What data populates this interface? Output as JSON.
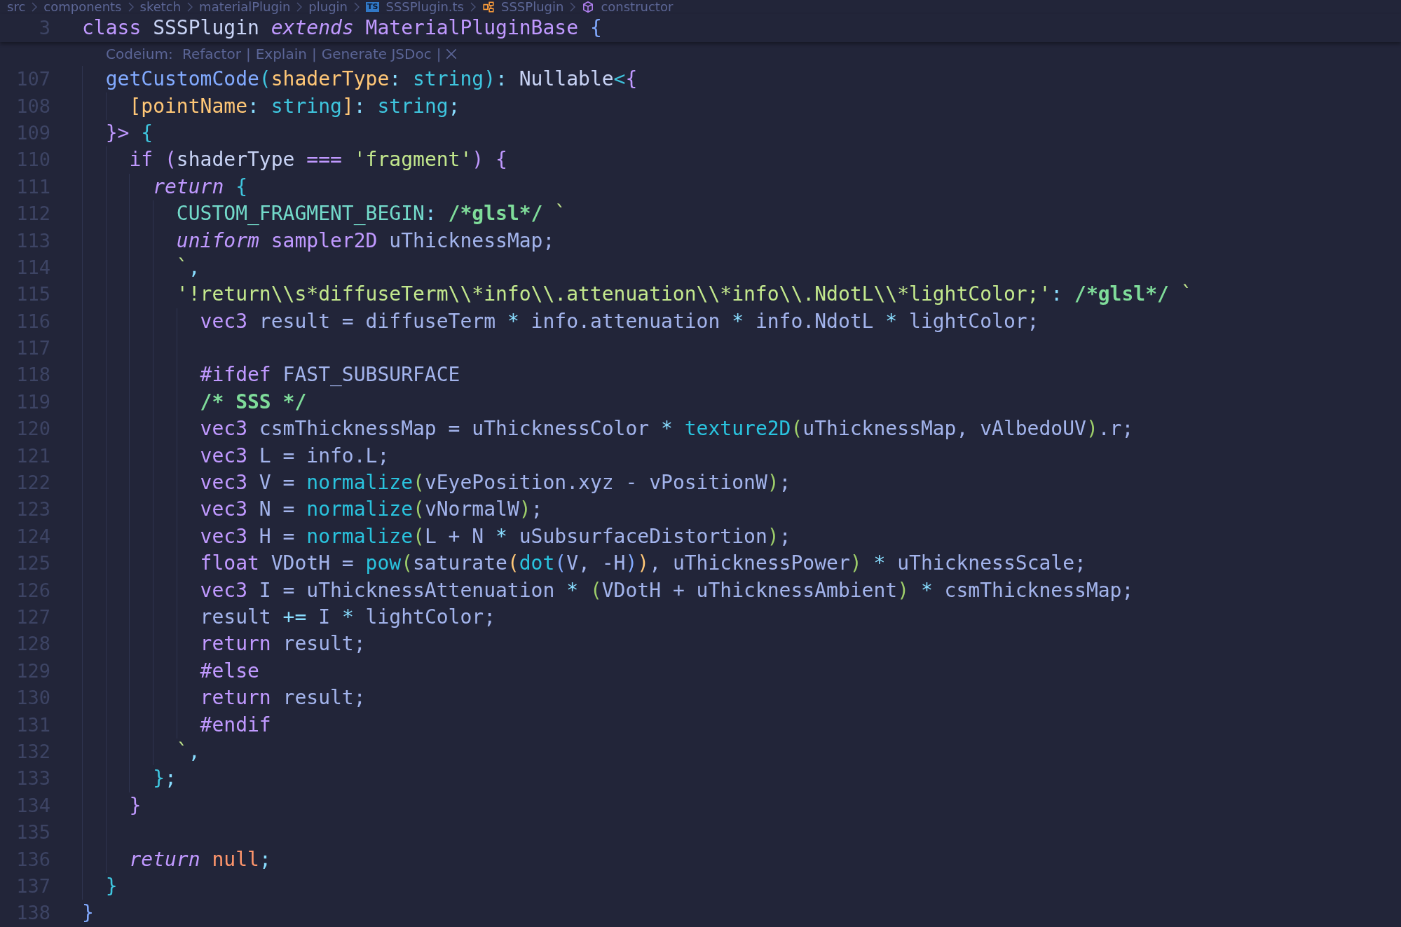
{
  "breadcrumbs": [
    {
      "label": "src",
      "kind": "folder"
    },
    {
      "label": "components",
      "kind": "folder"
    },
    {
      "label": "sketch",
      "kind": "folder"
    },
    {
      "label": "materialPlugin",
      "kind": "folder"
    },
    {
      "label": "plugin",
      "kind": "folder"
    },
    {
      "label": "SSSPlugin.ts",
      "kind": "file",
      "badge": "TS"
    },
    {
      "label": "SSSPlugin",
      "kind": "class"
    },
    {
      "label": "constructor",
      "kind": "method"
    }
  ],
  "sticky_line": {
    "number": "3",
    "tokens": [
      {
        "text": "class",
        "kind": "kw"
      },
      {
        "text": " SSSPlugin ",
        "kind": "plain"
      },
      {
        "text": "extends",
        "kind": "kwi"
      },
      {
        "text": " MaterialPluginBase ",
        "kind": "kw"
      },
      {
        "text": "{",
        "kind": "bb"
      }
    ]
  },
  "codelens": {
    "prefix": "Codeium: ",
    "actions": [
      "Refactor",
      "Explain",
      "Generate JSDoc"
    ],
    "separator": "|"
  },
  "lines": [
    {
      "number": "107",
      "tokens": [
        {
          "text": "  getCustomCode",
          "kind": "fn"
        },
        {
          "text": "(",
          "kind": "bc"
        },
        {
          "text": "shaderType",
          "kind": "param"
        },
        {
          "text": ": ",
          "kind": "op"
        },
        {
          "text": "string",
          "kind": "type"
        },
        {
          "text": ")",
          "kind": "bc"
        },
        {
          "text": ": ",
          "kind": "op"
        },
        {
          "text": "Nullable",
          "kind": "plain"
        },
        {
          "text": "<",
          "kind": "bc"
        },
        {
          "text": "{",
          "kind": "bp"
        }
      ]
    },
    {
      "number": "108",
      "tokens": [
        {
          "text": "    [",
          "kind": "bo"
        },
        {
          "text": "pointName",
          "kind": "param"
        },
        {
          "text": ": ",
          "kind": "op"
        },
        {
          "text": "string",
          "kind": "type"
        },
        {
          "text": "]",
          "kind": "bo"
        },
        {
          "text": ": ",
          "kind": "op"
        },
        {
          "text": "string",
          "kind": "type"
        },
        {
          "text": ";",
          "kind": "op"
        }
      ]
    },
    {
      "number": "109",
      "tokens": [
        {
          "text": "  }>",
          "kind": "bp"
        },
        {
          "text": " {",
          "kind": "bc"
        }
      ]
    },
    {
      "number": "110",
      "tokens": [
        {
          "text": "    if",
          "kind": "kw"
        },
        {
          "text": " (",
          "kind": "bp"
        },
        {
          "text": "shaderType",
          "kind": "plain"
        },
        {
          "text": " === ",
          "kind": "kw"
        },
        {
          "text": "'fragment'",
          "kind": "str"
        },
        {
          "text": ")",
          "kind": "bp"
        },
        {
          "text": " {",
          "kind": "bp"
        }
      ]
    },
    {
      "number": "111",
      "tokens": [
        {
          "text": "      return",
          "kind": "kwi"
        },
        {
          "text": " {",
          "kind": "bc"
        }
      ]
    },
    {
      "number": "112",
      "tokens": [
        {
          "text": "        CUSTOM_FRAGMENT_BEGIN",
          "kind": "prop"
        },
        {
          "text": ": ",
          "kind": "op"
        },
        {
          "text": "/*glsl*/",
          "kind": "comment"
        },
        {
          "text": " `",
          "kind": "str"
        }
      ]
    },
    {
      "number": "113",
      "tokens": [
        {
          "text": "        uniform",
          "kind": "kwi"
        },
        {
          "text": " sampler2D",
          "kind": "kw"
        },
        {
          "text": " uThicknessMap;",
          "kind": "var"
        }
      ]
    },
    {
      "number": "114",
      "tokens": [
        {
          "text": "        `",
          "kind": "str"
        },
        {
          "text": ",",
          "kind": "op"
        }
      ]
    },
    {
      "number": "115",
      "tokens": [
        {
          "text": "        '!return\\\\s*diffuseTerm\\\\*info\\\\.attenuation\\\\*info\\\\.NdotL\\\\*lightColor;'",
          "kind": "str"
        },
        {
          "text": ": ",
          "kind": "op"
        },
        {
          "text": "/*glsl*/",
          "kind": "comment"
        },
        {
          "text": " `",
          "kind": "str"
        }
      ]
    },
    {
      "number": "116",
      "tokens": [
        {
          "text": "          vec3",
          "kind": "kw"
        },
        {
          "text": " result = diffuseTerm ",
          "kind": "var"
        },
        {
          "text": "*",
          "kind": "op"
        },
        {
          "text": " info.attenuation ",
          "kind": "var"
        },
        {
          "text": "*",
          "kind": "op"
        },
        {
          "text": " info.NdotL ",
          "kind": "var"
        },
        {
          "text": "*",
          "kind": "op"
        },
        {
          "text": " lightColor;",
          "kind": "var"
        }
      ]
    },
    {
      "number": "117"
    },
    {
      "number": "118",
      "tokens": [
        {
          "text": "          #ifdef",
          "kind": "kw"
        },
        {
          "text": " FAST_SUBSURFACE",
          "kind": "var"
        }
      ]
    },
    {
      "number": "119",
      "tokens": [
        {
          "text": "          /* SSS */",
          "kind": "comment"
        }
      ]
    },
    {
      "number": "120",
      "tokens": [
        {
          "text": "          vec3",
          "kind": "kw"
        },
        {
          "text": " csmThicknessMap = uThicknessColor ",
          "kind": "var"
        },
        {
          "text": "*",
          "kind": "op"
        },
        {
          "text": " texture2D",
          "kind": "builtin"
        },
        {
          "text": "(",
          "kind": "bg"
        },
        {
          "text": "uThicknessMap, vAlbedoUV",
          "kind": "var"
        },
        {
          "text": ")",
          "kind": "bg"
        },
        {
          "text": ".r;",
          "kind": "var"
        }
      ]
    },
    {
      "number": "121",
      "tokens": [
        {
          "text": "          vec3",
          "kind": "kw"
        },
        {
          "text": " L = info.L;",
          "kind": "var"
        }
      ]
    },
    {
      "number": "122",
      "tokens": [
        {
          "text": "          vec3",
          "kind": "kw"
        },
        {
          "text": " V = ",
          "kind": "var"
        },
        {
          "text": "normalize",
          "kind": "builtin"
        },
        {
          "text": "(",
          "kind": "bg"
        },
        {
          "text": "vEyePosition.xyz - vPositionW",
          "kind": "var"
        },
        {
          "text": ")",
          "kind": "bg"
        },
        {
          "text": ";",
          "kind": "var"
        }
      ]
    },
    {
      "number": "123",
      "tokens": [
        {
          "text": "          vec3",
          "kind": "kw"
        },
        {
          "text": " N = ",
          "kind": "var"
        },
        {
          "text": "normalize",
          "kind": "builtin"
        },
        {
          "text": "(",
          "kind": "bg"
        },
        {
          "text": "vNormalW",
          "kind": "var"
        },
        {
          "text": ")",
          "kind": "bg"
        },
        {
          "text": ";",
          "kind": "var"
        }
      ]
    },
    {
      "number": "124",
      "tokens": [
        {
          "text": "          vec3",
          "kind": "kw"
        },
        {
          "text": " H = ",
          "kind": "var"
        },
        {
          "text": "normalize",
          "kind": "builtin"
        },
        {
          "text": "(",
          "kind": "bg"
        },
        {
          "text": "L + N ",
          "kind": "var"
        },
        {
          "text": "*",
          "kind": "op"
        },
        {
          "text": " uSubsurfaceDistortion",
          "kind": "var"
        },
        {
          "text": ")",
          "kind": "bg"
        },
        {
          "text": ";",
          "kind": "var"
        }
      ]
    },
    {
      "number": "125",
      "tokens": [
        {
          "text": "          float",
          "kind": "kw"
        },
        {
          "text": " VDotH = ",
          "kind": "var"
        },
        {
          "text": "pow",
          "kind": "builtin"
        },
        {
          "text": "(",
          "kind": "bg"
        },
        {
          "text": "saturate",
          "kind": "var"
        },
        {
          "text": "(",
          "kind": "bo"
        },
        {
          "text": "dot",
          "kind": "builtin"
        },
        {
          "text": "(",
          "kind": "bb"
        },
        {
          "text": "V, -H",
          "kind": "var"
        },
        {
          "text": ")",
          "kind": "bb"
        },
        {
          "text": ")",
          "kind": "bo"
        },
        {
          "text": ", uThicknessPower",
          "kind": "var"
        },
        {
          "text": ")",
          "kind": "bg"
        },
        {
          "text": " * ",
          "kind": "op"
        },
        {
          "text": "uThicknessScale;",
          "kind": "var"
        }
      ]
    },
    {
      "number": "126",
      "tokens": [
        {
          "text": "          vec3",
          "kind": "kw"
        },
        {
          "text": " I = uThicknessAttenuation ",
          "kind": "var"
        },
        {
          "text": "* ",
          "kind": "op"
        },
        {
          "text": "(",
          "kind": "bg"
        },
        {
          "text": "VDotH + uThicknessAmbient",
          "kind": "var"
        },
        {
          "text": ")",
          "kind": "bg"
        },
        {
          "text": " * ",
          "kind": "op"
        },
        {
          "text": "csmThicknessMap;",
          "kind": "var"
        }
      ]
    },
    {
      "number": "127",
      "tokens": [
        {
          "text": "          result ",
          "kind": "var"
        },
        {
          "text": "+=",
          "kind": "op"
        },
        {
          "text": " I ",
          "kind": "var"
        },
        {
          "text": "*",
          "kind": "op"
        },
        {
          "text": " lightColor;",
          "kind": "var"
        }
      ]
    },
    {
      "number": "128",
      "tokens": [
        {
          "text": "          return",
          "kind": "kw"
        },
        {
          "text": " result;",
          "kind": "var"
        }
      ]
    },
    {
      "number": "129",
      "tokens": [
        {
          "text": "          #else",
          "kind": "kw"
        }
      ]
    },
    {
      "number": "130",
      "tokens": [
        {
          "text": "          return",
          "kind": "kw"
        },
        {
          "text": " result;",
          "kind": "var"
        }
      ]
    },
    {
      "number": "131",
      "tokens": [
        {
          "text": "          #endif",
          "kind": "kw"
        }
      ]
    },
    {
      "number": "132",
      "tokens": [
        {
          "text": "        `",
          "kind": "str"
        },
        {
          "text": ",",
          "kind": "op"
        }
      ]
    },
    {
      "number": "133",
      "tokens": [
        {
          "text": "      }",
          "kind": "bc"
        },
        {
          "text": ";",
          "kind": "op"
        }
      ]
    },
    {
      "number": "134",
      "tokens": [
        {
          "text": "    }",
          "kind": "bp"
        }
      ]
    },
    {
      "number": "135"
    },
    {
      "number": "136",
      "tokens": [
        {
          "text": "    return",
          "kind": "kwi"
        },
        {
          "text": " null",
          "kind": "const"
        },
        {
          "text": ";",
          "kind": "op"
        }
      ]
    },
    {
      "number": "137",
      "tokens": [
        {
          "text": "  }",
          "kind": "bc"
        }
      ]
    },
    {
      "number": "138",
      "tokens": [
        {
          "text": "}",
          "kind": "bb"
        }
      ]
    }
  ]
}
